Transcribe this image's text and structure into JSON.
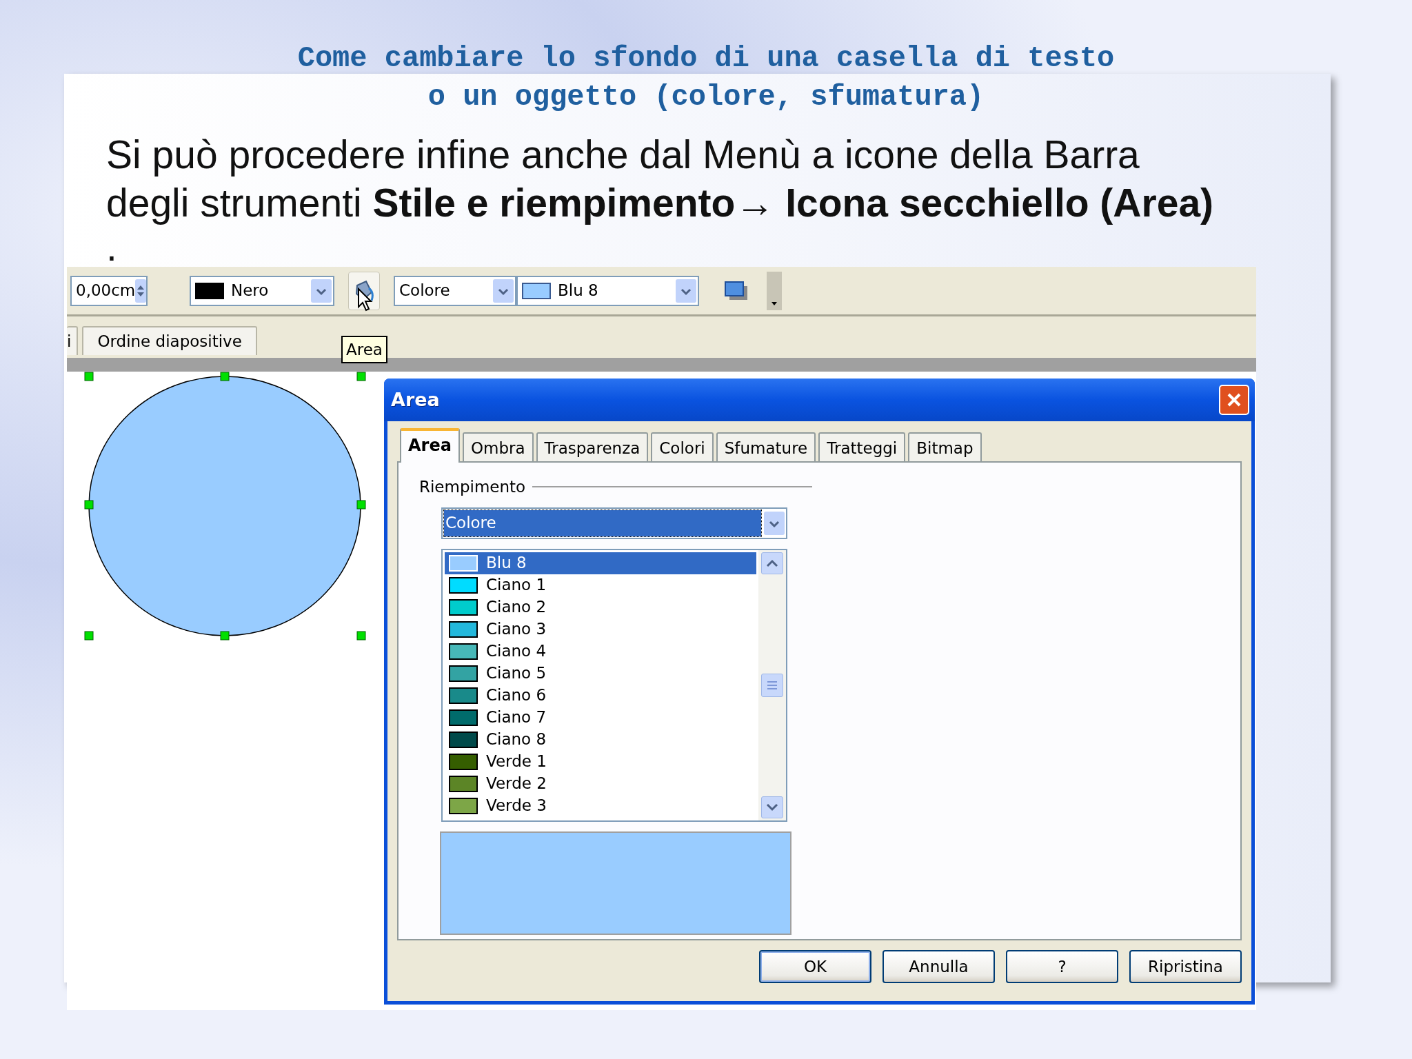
{
  "slide": {
    "title_lines": [
      "Come cambiare lo sfondo di una casella di testo",
      "o un oggetto (colore, sfumatura)"
    ],
    "body": "Si può procedere infine anche dal Menù a icone della Barra degli strumenti **Stile e riempimento**→ **Icona secchiello (Area)**",
    "bullet": "."
  },
  "toolbar": {
    "line_width": "0,00cm",
    "line_color": {
      "label": "Nero",
      "color": "#000000"
    },
    "tooltip": "Area",
    "fill_type": "Colore",
    "fill_color": {
      "label": "Blu 8",
      "color": "#99ccff"
    }
  },
  "view_tabs": [
    {
      "label": "i"
    },
    {
      "label": "Ordine diapositive"
    }
  ],
  "dialog": {
    "title": "Area",
    "tabs": [
      {
        "label": "Area",
        "selected": true
      },
      {
        "label": "Ombra",
        "selected": false
      },
      {
        "label": "Trasparenza",
        "selected": false
      },
      {
        "label": "Colori",
        "selected": false
      },
      {
        "label": "Sfumature",
        "selected": false
      },
      {
        "label": "Tratteggi",
        "selected": false
      },
      {
        "label": "Bitmap",
        "selected": false
      }
    ],
    "group_label": "Riempimento",
    "fill_type": "Colore",
    "colors": [
      {
        "label": "Blu 8",
        "color": "#99ccff",
        "selected": true
      },
      {
        "label": "Ciano 1",
        "color": "#00dcff",
        "selected": false
      },
      {
        "label": "Ciano 2",
        "color": "#00cccc",
        "selected": false
      },
      {
        "label": "Ciano 3",
        "color": "#23b8dc",
        "selected": false
      },
      {
        "label": "Ciano 4",
        "color": "#47b8b8",
        "selected": false
      },
      {
        "label": "Ciano 5",
        "color": "#33a3a3",
        "selected": false
      },
      {
        "label": "Ciano 6",
        "color": "#198a8a",
        "selected": false
      },
      {
        "label": "Ciano 7",
        "color": "#006b6b",
        "selected": false
      },
      {
        "label": "Ciano 8",
        "color": "#004a4a",
        "selected": false
      },
      {
        "label": "Verde 1",
        "color": "#355e00",
        "selected": false
      },
      {
        "label": "Verde 2",
        "color": "#5c8526",
        "selected": false
      },
      {
        "label": "Verde 3",
        "color": "#7da647",
        "selected": false
      }
    ],
    "buttons": [
      "OK",
      "Annulla",
      "?",
      "Ripristina"
    ]
  }
}
